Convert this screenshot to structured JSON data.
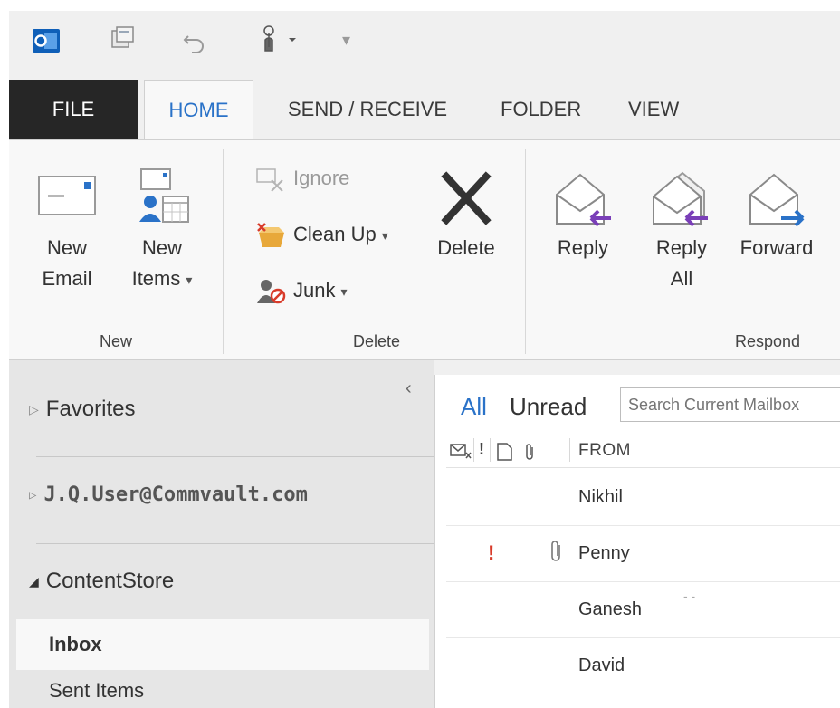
{
  "qat": {
    "outlook_icon": "outlook-logo-icon",
    "buttons": [
      "send-receive-all-icon",
      "undo-icon",
      "touch-mode-icon",
      "customize-qat-icon"
    ]
  },
  "tabs": [
    "FILE",
    "HOME",
    "SEND / RECEIVE",
    "FOLDER",
    "VIEW"
  ],
  "ribbon": {
    "new_group": {
      "label": "New",
      "new_email": [
        "New",
        "Email"
      ],
      "new_items": [
        "New",
        "Items"
      ]
    },
    "delete_group": {
      "label": "Delete",
      "ignore": "Ignore",
      "clean_up": "Clean Up",
      "junk": "Junk",
      "delete": "Delete"
    },
    "respond_group": {
      "label": "Respond",
      "reply": "Reply",
      "reply_all": [
        "Reply",
        "All"
      ],
      "forward": "Forward"
    }
  },
  "folder_pane": {
    "favorites": "Favorites",
    "account": "J.Q.User@Commvault.com",
    "store": "ContentStore",
    "inbox": "Inbox",
    "sent_items": "Sent Items"
  },
  "message_list": {
    "filter_all": "All",
    "filter_unread": "Unread",
    "search_placeholder": "Search Current Mailbox",
    "from_header": "FROM",
    "messages": [
      {
        "from": "Nikhil",
        "important": false,
        "attachment": false
      },
      {
        "from": "Penny",
        "important": true,
        "attachment": true
      },
      {
        "from": "Ganesh",
        "important": false,
        "attachment": false
      },
      {
        "from": "David",
        "important": false,
        "attachment": false
      }
    ],
    "importance_mark": "!",
    "ganesh_preview": "- -"
  },
  "colors": {
    "accent": "#2a72c8",
    "file_tab_bg": "#262626",
    "importance": "#d83b2a",
    "reply_arrow": "#7a3fb8",
    "forward_arrow": "#2a72c8"
  }
}
